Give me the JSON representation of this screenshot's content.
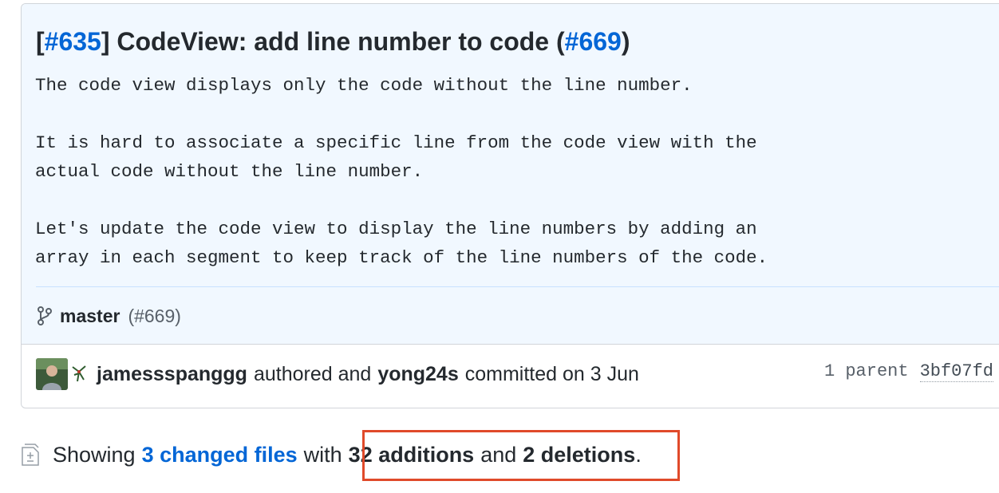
{
  "commit": {
    "title_open_bracket": "[",
    "title_issue": "#635",
    "title_text": "] CodeView: add line number to code (",
    "title_pr": "#669",
    "title_close": ")",
    "description": "The code view displays only the code without the line number.\n\nIt is hard to associate a specific line from the code view with the\nactual code without the line number.\n\nLet's update the code view to display the line numbers by adding an\narray in each segment to keep track of the line numbers of the code.",
    "branch_name": "master",
    "branch_pr": "(#669)"
  },
  "meta": {
    "author": "jamessspanggg",
    "authored_text": "authored and",
    "committer": "yong24s",
    "committed_text": "committed on 3 Jun",
    "parent_text": "1 parent",
    "sha": "3bf07fd"
  },
  "summary": {
    "showing": "Showing",
    "changed_files": "3 changed files",
    "with": "with",
    "additions": "32 additions",
    "and": "and",
    "deletions": "2 deletions",
    "period": "."
  },
  "icons": {
    "branch": "git-branch-icon",
    "diff": "file-diff-icon"
  },
  "colors": {
    "link": "#0366d6",
    "header_bg": "#f1f8ff",
    "highlight": "#e04a2a"
  }
}
